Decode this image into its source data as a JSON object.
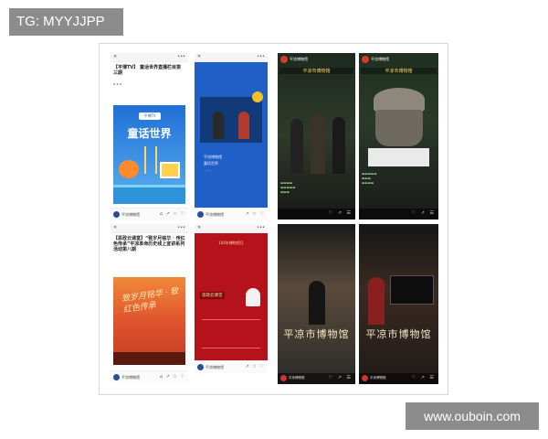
{
  "watermarks": {
    "top_left": "TG: MYYJJPP",
    "bottom_right": "www.ouboin.com"
  },
  "cards": {
    "card1": {
      "title": "【平博TV】 童话世界直播栏目第三期",
      "poster_label": "平博TV",
      "poster_title": "童话世界",
      "account": "平凉博物馆",
      "colors": {
        "sky": "#2a7fd4",
        "accent": "#f4a01a"
      }
    },
    "card2": {
      "account": "平凉博物馆",
      "body_lines": [
        "平凉博物馆",
        "童话世界",
        "……"
      ],
      "colors": {
        "bg": "#1f5fc6"
      }
    },
    "card3": {
      "banner": "平凉市博物馆",
      "account": "平凉博物馆"
    },
    "card4": {
      "banner": "平凉市博物馆",
      "account": "平凉博物馆"
    },
    "card5": {
      "title": "【思政云课堂】“致岁月铭华 · 传红色传承”平凉革命历史线上宣讲系列活动第八期",
      "account": "平凉博物馆",
      "poster_text": "致岁月铭华 · 致红色传承",
      "colors": {
        "bg": "#e0542d"
      }
    },
    "card6": {
      "header": "104年博物馆日",
      "badge": "思政云课堂",
      "account": "平凉博物馆",
      "colors": {
        "bg": "#b5121b"
      }
    },
    "card7": {
      "museum_name": "平凉市博物馆",
      "account": "平凉博物馆"
    },
    "card8": {
      "museum_name": "平凉市博物馆",
      "account": "平凉博物馆"
    }
  }
}
